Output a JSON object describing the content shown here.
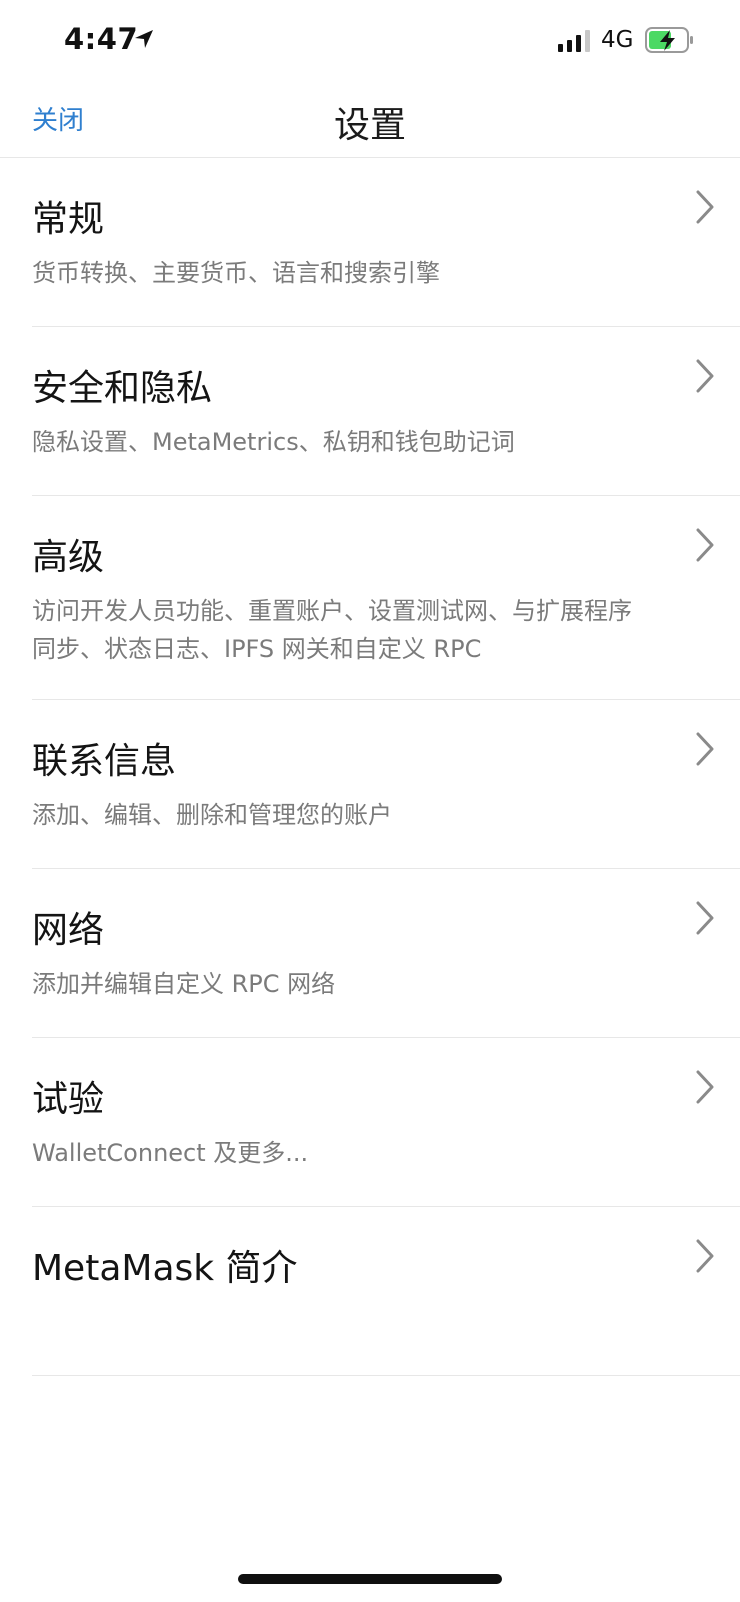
{
  "status_bar": {
    "time": "4:47",
    "network": "4G",
    "icons": [
      "location-arrow-icon",
      "signal-bars-icon",
      "battery-charging-icon"
    ],
    "battery_color": "#4cd964"
  },
  "nav": {
    "close_label": "关闭",
    "title": "设置",
    "accent_color": "#2f7fcf"
  },
  "settings": {
    "items": [
      {
        "title": "常规",
        "desc": "货币转换、主要货币、语言和搜索引擎"
      },
      {
        "title": "安全和隐私",
        "desc": "隐私设置、MetaMetrics、私钥和钱包助记词"
      },
      {
        "title": "高级",
        "desc": "访问开发人员功能、重置账户、设置测试网、与扩展程序同步、状态日志、IPFS 网关和自定义 RPC"
      },
      {
        "title": "联系信息",
        "desc": "添加、编辑、删除和管理您的账户"
      },
      {
        "title": "网络",
        "desc": "添加并编辑自定义 RPC 网络"
      },
      {
        "title": "试验",
        "desc": "WalletConnect 及更多..."
      },
      {
        "title": "MetaMask 简介",
        "desc": ""
      }
    ]
  }
}
